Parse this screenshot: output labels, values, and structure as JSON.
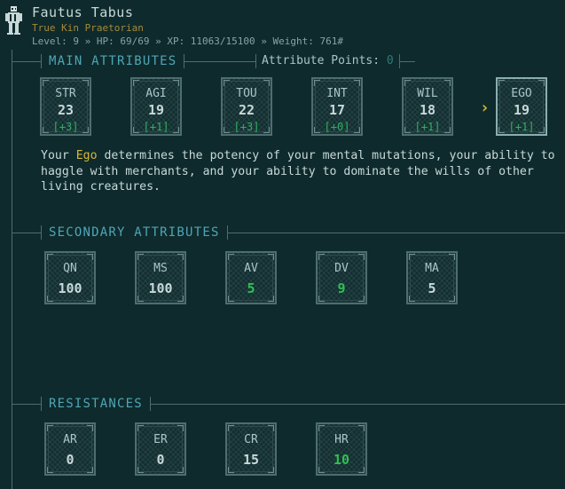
{
  "character": {
    "name": "Fautus Tabus",
    "subtitle": "True Kin Praetorian",
    "stats_line": "Level: 9 » HP: 69/69 » XP: 11063/15100 » Weight: 761#"
  },
  "main_attributes": {
    "title": "MAIN ATTRIBUTES",
    "points_label": "Attribute Points:",
    "points_value": "0",
    "selected_marker": "›",
    "items": [
      {
        "abbr": "STR",
        "value": "23",
        "mod": "[+3]"
      },
      {
        "abbr": "AGI",
        "value": "19",
        "mod": "[+1]"
      },
      {
        "abbr": "TOU",
        "value": "22",
        "mod": "[+3]"
      },
      {
        "abbr": "INT",
        "value": "17",
        "mod": "[+0]"
      },
      {
        "abbr": "WIL",
        "value": "18",
        "mod": "[+1]"
      },
      {
        "abbr": "EGO",
        "value": "19",
        "mod": "[+1]"
      }
    ],
    "description_before": "Your ",
    "description_highlight": "Ego",
    "description_after": " determines the potency of your mental mutations, your ability to haggle with merchants, and your ability to dominate the wills of other living creatures."
  },
  "secondary_attributes": {
    "title": "SECONDARY ATTRIBUTES",
    "items": [
      {
        "abbr": "QN",
        "value": "100"
      },
      {
        "abbr": "MS",
        "value": "100"
      },
      {
        "abbr": "AV",
        "value": "5"
      },
      {
        "abbr": "DV",
        "value": "9"
      },
      {
        "abbr": "MA",
        "value": "5"
      }
    ]
  },
  "resistances": {
    "title": "RESISTANCES",
    "items": [
      {
        "abbr": "AR",
        "value": "0"
      },
      {
        "abbr": "ER",
        "value": "0"
      },
      {
        "abbr": "CR",
        "value": "15"
      },
      {
        "abbr": "HR",
        "value": "10"
      }
    ]
  },
  "colors": {
    "background": "#0e2a2c",
    "accent_cyan": "#4fa6b6",
    "highlight_yellow": "#d7b836",
    "modifier_green": "#2fb160",
    "subtitle_gold": "#a58a3c"
  }
}
